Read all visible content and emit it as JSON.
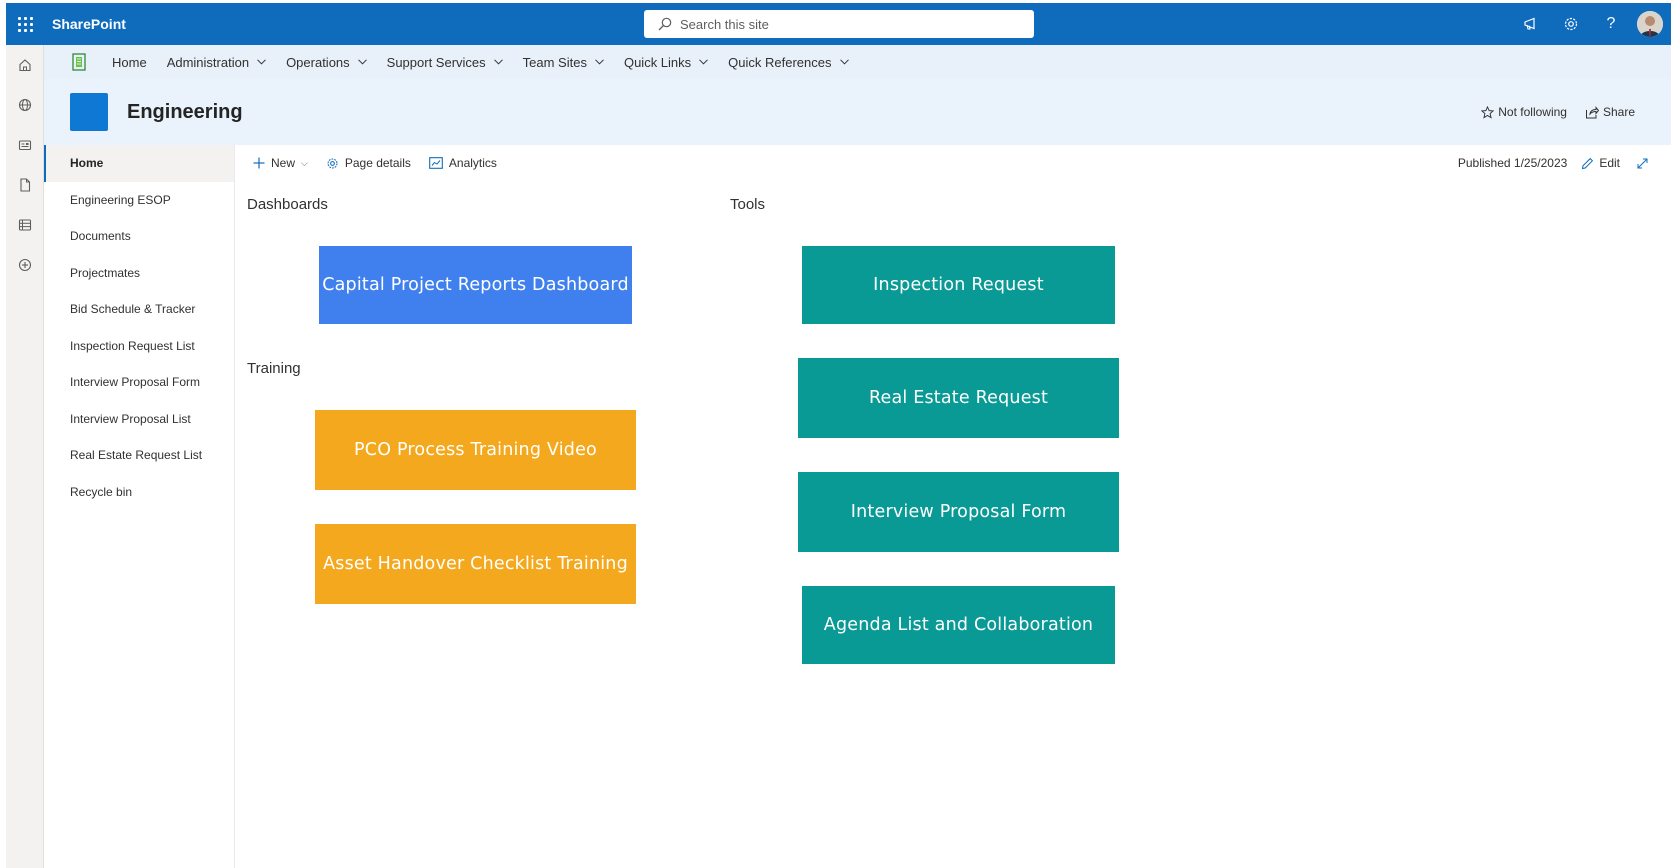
{
  "suite": {
    "app_name": "SharePoint",
    "search_placeholder": "Search this site"
  },
  "hub_nav": {
    "items": [
      {
        "label": "Home",
        "has_menu": false
      },
      {
        "label": "Administration",
        "has_menu": true
      },
      {
        "label": "Operations",
        "has_menu": true
      },
      {
        "label": "Support Services",
        "has_menu": true
      },
      {
        "label": "Team Sites",
        "has_menu": true
      },
      {
        "label": "Quick Links",
        "has_menu": true
      },
      {
        "label": "Quick References",
        "has_menu": true
      }
    ]
  },
  "site": {
    "title": "Engineering",
    "logo_color": "#0f78d4",
    "follow_label": "Not following",
    "share_label": "Share"
  },
  "left_nav": {
    "items": [
      {
        "label": "Home",
        "active": true
      },
      {
        "label": "Engineering ESOP",
        "active": false
      },
      {
        "label": "Documents",
        "active": false
      },
      {
        "label": "Projectmates",
        "active": false
      },
      {
        "label": "Bid Schedule & Tracker",
        "active": false
      },
      {
        "label": "Inspection Request List",
        "active": false
      },
      {
        "label": "Interview Proposal Form",
        "active": false
      },
      {
        "label": "Interview Proposal List",
        "active": false
      },
      {
        "label": "Real Estate Request List",
        "active": false
      },
      {
        "label": "Recycle bin",
        "active": false
      }
    ]
  },
  "command_bar": {
    "new_label": "New",
    "page_details_label": "Page details",
    "analytics_label": "Analytics",
    "published_label": "Published 1/25/2023",
    "edit_label": "Edit"
  },
  "content": {
    "dashboards": {
      "heading": "Dashboards",
      "tiles": [
        {
          "label": "Capital Project Reports Dashboard",
          "color": "#4080ee"
        }
      ]
    },
    "training": {
      "heading": "Training",
      "tiles": [
        {
          "label": "PCO Process Training Video",
          "color": "#f4a81d"
        },
        {
          "label": "Asset Handover Checklist Training",
          "color": "#f4a81d"
        }
      ]
    },
    "tools": {
      "heading": "Tools",
      "tiles": [
        {
          "label": "Inspection Request",
          "color": "#0a9a95"
        },
        {
          "label": "Real Estate Request",
          "color": "#0a9a95"
        },
        {
          "label": "Interview Proposal Form",
          "color": "#0a9a95"
        },
        {
          "label": "Agenda List and Collaboration",
          "color": "#0a9a95"
        }
      ]
    }
  },
  "colors": {
    "suite_bar": "#0f6cbd",
    "hub_nav_bg": "#e8f0f9",
    "site_header_bg": "#eaf2fb"
  }
}
